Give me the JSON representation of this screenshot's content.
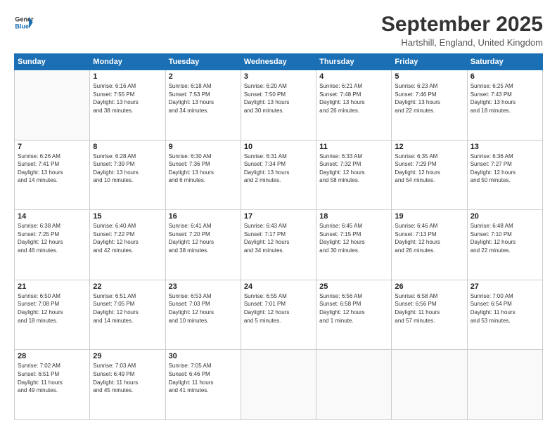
{
  "header": {
    "logo_line1": "General",
    "logo_line2": "Blue",
    "month": "September 2025",
    "location": "Hartshill, England, United Kingdom"
  },
  "days_of_week": [
    "Sunday",
    "Monday",
    "Tuesday",
    "Wednesday",
    "Thursday",
    "Friday",
    "Saturday"
  ],
  "weeks": [
    [
      {
        "day": "",
        "info": ""
      },
      {
        "day": "1",
        "info": "Sunrise: 6:16 AM\nSunset: 7:55 PM\nDaylight: 13 hours\nand 38 minutes."
      },
      {
        "day": "2",
        "info": "Sunrise: 6:18 AM\nSunset: 7:53 PM\nDaylight: 13 hours\nand 34 minutes."
      },
      {
        "day": "3",
        "info": "Sunrise: 6:20 AM\nSunset: 7:50 PM\nDaylight: 13 hours\nand 30 minutes."
      },
      {
        "day": "4",
        "info": "Sunrise: 6:21 AM\nSunset: 7:48 PM\nDaylight: 13 hours\nand 26 minutes."
      },
      {
        "day": "5",
        "info": "Sunrise: 6:23 AM\nSunset: 7:46 PM\nDaylight: 13 hours\nand 22 minutes."
      },
      {
        "day": "6",
        "info": "Sunrise: 6:25 AM\nSunset: 7:43 PM\nDaylight: 13 hours\nand 18 minutes."
      }
    ],
    [
      {
        "day": "7",
        "info": "Sunrise: 6:26 AM\nSunset: 7:41 PM\nDaylight: 13 hours\nand 14 minutes."
      },
      {
        "day": "8",
        "info": "Sunrise: 6:28 AM\nSunset: 7:39 PM\nDaylight: 13 hours\nand 10 minutes."
      },
      {
        "day": "9",
        "info": "Sunrise: 6:30 AM\nSunset: 7:36 PM\nDaylight: 13 hours\nand 6 minutes."
      },
      {
        "day": "10",
        "info": "Sunrise: 6:31 AM\nSunset: 7:34 PM\nDaylight: 13 hours\nand 2 minutes."
      },
      {
        "day": "11",
        "info": "Sunrise: 6:33 AM\nSunset: 7:32 PM\nDaylight: 12 hours\nand 58 minutes."
      },
      {
        "day": "12",
        "info": "Sunrise: 6:35 AM\nSunset: 7:29 PM\nDaylight: 12 hours\nand 54 minutes."
      },
      {
        "day": "13",
        "info": "Sunrise: 6:36 AM\nSunset: 7:27 PM\nDaylight: 12 hours\nand 50 minutes."
      }
    ],
    [
      {
        "day": "14",
        "info": "Sunrise: 6:38 AM\nSunset: 7:25 PM\nDaylight: 12 hours\nand 46 minutes."
      },
      {
        "day": "15",
        "info": "Sunrise: 6:40 AM\nSunset: 7:22 PM\nDaylight: 12 hours\nand 42 minutes."
      },
      {
        "day": "16",
        "info": "Sunrise: 6:41 AM\nSunset: 7:20 PM\nDaylight: 12 hours\nand 38 minutes."
      },
      {
        "day": "17",
        "info": "Sunrise: 6:43 AM\nSunset: 7:17 PM\nDaylight: 12 hours\nand 34 minutes."
      },
      {
        "day": "18",
        "info": "Sunrise: 6:45 AM\nSunset: 7:15 PM\nDaylight: 12 hours\nand 30 minutes."
      },
      {
        "day": "19",
        "info": "Sunrise: 6:46 AM\nSunset: 7:13 PM\nDaylight: 12 hours\nand 26 minutes."
      },
      {
        "day": "20",
        "info": "Sunrise: 6:48 AM\nSunset: 7:10 PM\nDaylight: 12 hours\nand 22 minutes."
      }
    ],
    [
      {
        "day": "21",
        "info": "Sunrise: 6:50 AM\nSunset: 7:08 PM\nDaylight: 12 hours\nand 18 minutes."
      },
      {
        "day": "22",
        "info": "Sunrise: 6:51 AM\nSunset: 7:05 PM\nDaylight: 12 hours\nand 14 minutes."
      },
      {
        "day": "23",
        "info": "Sunrise: 6:53 AM\nSunset: 7:03 PM\nDaylight: 12 hours\nand 10 minutes."
      },
      {
        "day": "24",
        "info": "Sunrise: 6:55 AM\nSunset: 7:01 PM\nDaylight: 12 hours\nand 5 minutes."
      },
      {
        "day": "25",
        "info": "Sunrise: 6:56 AM\nSunset: 6:58 PM\nDaylight: 12 hours\nand 1 minute."
      },
      {
        "day": "26",
        "info": "Sunrise: 6:58 AM\nSunset: 6:56 PM\nDaylight: 11 hours\nand 57 minutes."
      },
      {
        "day": "27",
        "info": "Sunrise: 7:00 AM\nSunset: 6:54 PM\nDaylight: 11 hours\nand 53 minutes."
      }
    ],
    [
      {
        "day": "28",
        "info": "Sunrise: 7:02 AM\nSunset: 6:51 PM\nDaylight: 11 hours\nand 49 minutes."
      },
      {
        "day": "29",
        "info": "Sunrise: 7:03 AM\nSunset: 6:49 PM\nDaylight: 11 hours\nand 45 minutes."
      },
      {
        "day": "30",
        "info": "Sunrise: 7:05 AM\nSunset: 6:46 PM\nDaylight: 11 hours\nand 41 minutes."
      },
      {
        "day": "",
        "info": ""
      },
      {
        "day": "",
        "info": ""
      },
      {
        "day": "",
        "info": ""
      },
      {
        "day": "",
        "info": ""
      }
    ]
  ]
}
